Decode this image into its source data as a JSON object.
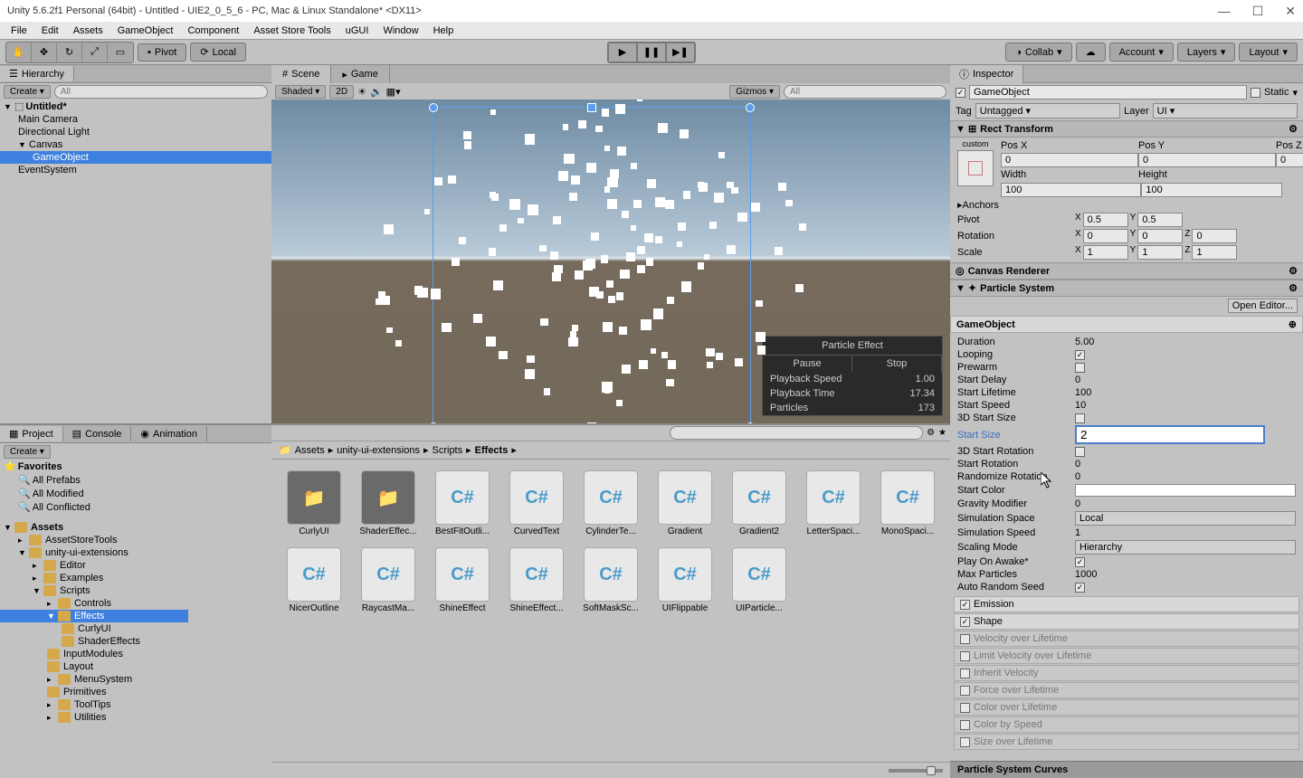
{
  "title": "Unity 5.6.2f1 Personal (64bit) - Untitled - UIE2_0_5_6 - PC, Mac & Linux Standalone* <DX11>",
  "menu": [
    "File",
    "Edit",
    "Assets",
    "GameObject",
    "Component",
    "Asset Store Tools",
    "uGUI",
    "Window",
    "Help"
  ],
  "toolbar": {
    "pivot": "Pivot",
    "local": "Local",
    "collab": "Collab",
    "account": "Account",
    "layers": "Layers",
    "layout": "Layout"
  },
  "hierarchy": {
    "title": "Hierarchy",
    "create": "Create",
    "search_ph": "All",
    "root": "Untitled*",
    "items": [
      "Main Camera",
      "Directional Light",
      "Canvas",
      "GameObject",
      "EventSystem"
    ]
  },
  "scene": {
    "tab_scene": "Scene",
    "tab_game": "Game",
    "shaded": "Shaded",
    "_2d": "2D",
    "gizmos": "Gizmos",
    "search_ph": "All"
  },
  "particle_overlay": {
    "title": "Particle Effect",
    "pause": "Pause",
    "stop": "Stop",
    "rows": [
      [
        "Playback Speed",
        "1.00"
      ],
      [
        "Playback Time",
        "17.34"
      ],
      [
        "Particles",
        "173"
      ]
    ]
  },
  "project": {
    "title": "Project",
    "console": "Console",
    "animation": "Animation",
    "create": "Create",
    "favorites": "Favorites",
    "fav_items": [
      "All Prefabs",
      "All Modified",
      "All Conflicted"
    ],
    "assets": "Assets",
    "tree": [
      "AssetStoreTools",
      "unity-ui-extensions",
      "Editor",
      "Examples",
      "Scripts",
      "Controls",
      "Effects",
      "CurlyUI",
      "ShaderEffects",
      "InputModules",
      "Layout",
      "MenuSystem",
      "Primitives",
      "ToolTips",
      "Utilities"
    ],
    "breadcrumb": [
      "Assets",
      "unity-ui-extensions",
      "Scripts",
      "Effects"
    ],
    "asset_items": [
      {
        "name": "CurlyUI",
        "type": "folder"
      },
      {
        "name": "ShaderEffec...",
        "type": "folder"
      },
      {
        "name": "BestFitOutli...",
        "type": "cs"
      },
      {
        "name": "CurvedText",
        "type": "cs"
      },
      {
        "name": "CylinderTe...",
        "type": "cs"
      },
      {
        "name": "Gradient",
        "type": "cs"
      },
      {
        "name": "Gradient2",
        "type": "cs"
      },
      {
        "name": "LetterSpaci...",
        "type": "cs"
      },
      {
        "name": "MonoSpaci...",
        "type": "cs"
      },
      {
        "name": "NicerOutline",
        "type": "cs"
      },
      {
        "name": "RaycastMa...",
        "type": "cs"
      },
      {
        "name": "ShineEffect",
        "type": "cs"
      },
      {
        "name": "ShineEffect...",
        "type": "cs"
      },
      {
        "name": "SoftMaskSc...",
        "type": "cs"
      },
      {
        "name": "UIFlippable",
        "type": "cs"
      },
      {
        "name": "UIParticle...",
        "type": "cs"
      }
    ]
  },
  "inspector": {
    "title": "Inspector",
    "name": "GameObject",
    "static": "Static",
    "tag": "Tag",
    "tag_val": "Untagged",
    "layer": "Layer",
    "layer_val": "UI",
    "rect": {
      "title": "Rect Transform",
      "custom": "custom",
      "posx": "Pos X",
      "posy": "Pos Y",
      "posz": "Pos Z",
      "px": "0",
      "py": "0",
      "pz": "0",
      "width": "Width",
      "height": "Height",
      "w": "100",
      "h": "100",
      "anchors": "Anchors",
      "pivot": "Pivot",
      "pivx": "0.5",
      "pivy": "0.5",
      "rotation": "Rotation",
      "rx": "0",
      "ry": "0",
      "rz": "0",
      "scale": "Scale",
      "sx": "1",
      "sy": "1",
      "sz": "1"
    },
    "canvas_renderer": "Canvas Renderer",
    "ps": {
      "title": "Particle System",
      "open": "Open Editor...",
      "name": "GameObject",
      "rows": [
        [
          "Duration",
          "5.00",
          "text"
        ],
        [
          "Looping",
          "",
          "check_on"
        ],
        [
          "Prewarm",
          "",
          "check_off"
        ],
        [
          "Start Delay",
          "0",
          "text"
        ],
        [
          "Start Lifetime",
          "100",
          "text"
        ],
        [
          "Start Speed",
          "10",
          "text"
        ],
        [
          "3D Start Size",
          "",
          "check_off"
        ],
        [
          "Start Size",
          "2",
          "input_hl"
        ],
        [
          "3D Start Rotation",
          "",
          "check_off"
        ],
        [
          "Start Rotation",
          "0",
          "text"
        ],
        [
          "Randomize Rotation",
          "0",
          "text"
        ],
        [
          "Start Color",
          "",
          "color"
        ],
        [
          "Gravity Modifier",
          "0",
          "text"
        ],
        [
          "Simulation Space",
          "Local",
          "dd"
        ],
        [
          "Simulation Speed",
          "1",
          "text"
        ],
        [
          "Scaling Mode",
          "Hierarchy",
          "dd"
        ],
        [
          "Play On Awake*",
          "",
          "check_on"
        ],
        [
          "Max Particles",
          "1000",
          "text"
        ],
        [
          "Auto Random Seed",
          "",
          "check_on"
        ]
      ],
      "modules": [
        [
          "Emission",
          true
        ],
        [
          "Shape",
          true
        ],
        [
          "Velocity over Lifetime",
          false
        ],
        [
          "Limit Velocity over Lifetime",
          false
        ],
        [
          "Inherit Velocity",
          false
        ],
        [
          "Force over Lifetime",
          false
        ],
        [
          "Color over Lifetime",
          false
        ],
        [
          "Color by Speed",
          false
        ],
        [
          "Size over Lifetime",
          false
        ]
      ],
      "curves": "Particle System Curves"
    }
  }
}
